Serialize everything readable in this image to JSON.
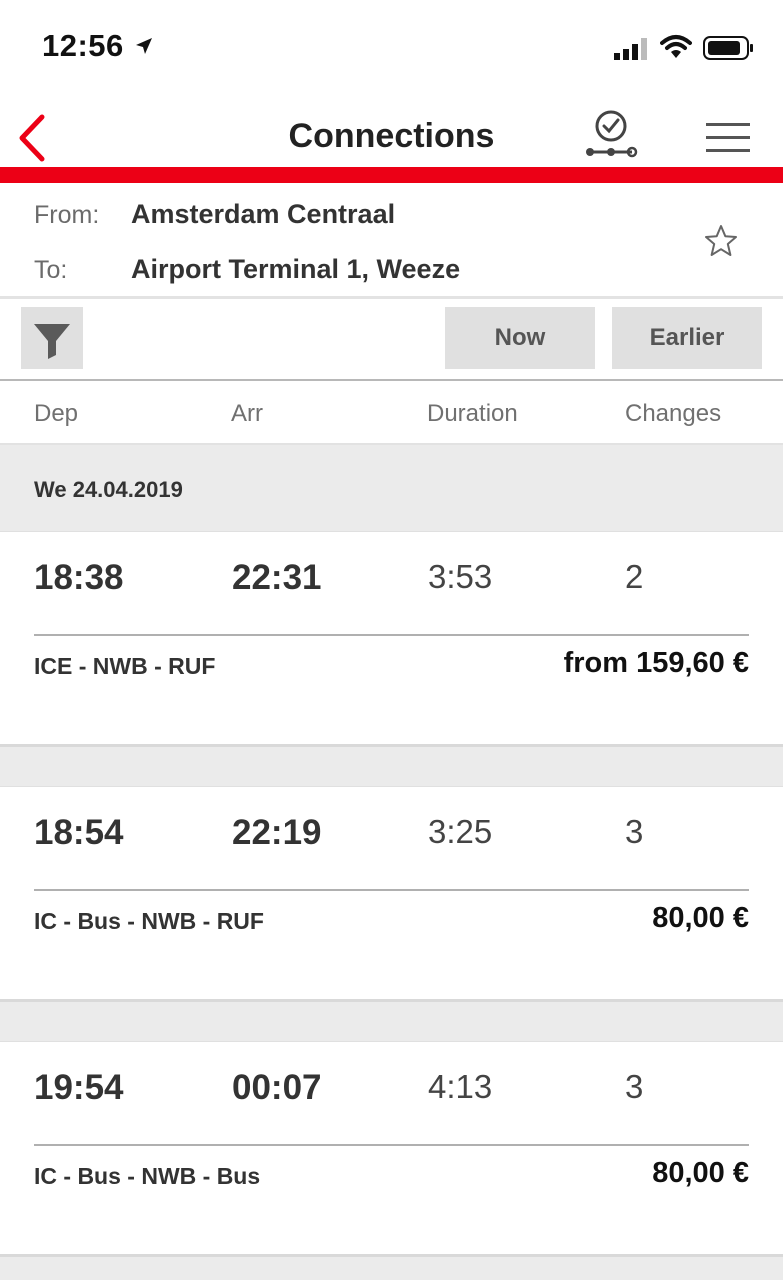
{
  "status_bar": {
    "time": "12:56"
  },
  "nav": {
    "title": "Connections"
  },
  "route": {
    "from_label": "From:",
    "from_value": "Amsterdam Centraal",
    "to_label": "To:",
    "to_value": "Airport Terminal 1, Weeze"
  },
  "toolbar": {
    "now_label": "Now",
    "earlier_label": "Earlier"
  },
  "columns": {
    "dep": "Dep",
    "arr": "Arr",
    "duration": "Duration",
    "changes": "Changes"
  },
  "date_header": "We 24.04.2019",
  "connections": [
    {
      "dep": "18:38",
      "arr": "22:31",
      "duration": "3:53",
      "changes": "2",
      "products": "ICE - NWB - RUF",
      "price": "from 159,60 €"
    },
    {
      "dep": "18:54",
      "arr": "22:19",
      "duration": "3:25",
      "changes": "3",
      "products": "IC - Bus - NWB - RUF",
      "price": "80,00 €"
    },
    {
      "dep": "19:54",
      "arr": "00:07",
      "duration": "4:13",
      "changes": "3",
      "products": "IC - Bus - NWB - Bus",
      "price": "80,00 €"
    }
  ],
  "icons": {
    "location": "location-arrow-icon",
    "signal": "cellular-signal-icon",
    "wifi": "wifi-icon",
    "battery": "battery-icon",
    "back": "chevron-left-icon",
    "timetable": "clock-route-icon",
    "menu": "hamburger-menu-icon",
    "favorite": "star-outline-icon",
    "filter": "filter-funnel-icon"
  },
  "colors": {
    "accent": "#ec0016"
  }
}
